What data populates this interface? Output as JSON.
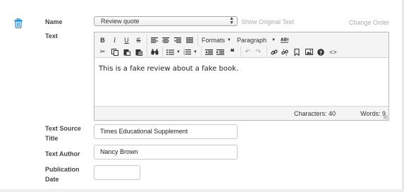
{
  "name_row": {
    "label": "Name",
    "select_value": "Review quote",
    "show_original": "Show Original Text",
    "change_order": "Change Order"
  },
  "text_row": {
    "label": "Text",
    "toolbar": {
      "formats_label": "Formats",
      "paragraph_label": "Paragraph"
    },
    "content": "This is a fake review about a fake book.",
    "status": {
      "characters": "Characters: 40",
      "words": "Words: 9"
    }
  },
  "text_source_title": {
    "label_line1": "Text Source",
    "label_line2": "Title",
    "value": "Times Educational Supplement"
  },
  "text_author": {
    "label": "Text Author",
    "value": "Nancy Brown"
  },
  "publication_date": {
    "label_line1": "Publication",
    "label_line2": "Date",
    "value": ""
  },
  "colors": {
    "trash_icon": "#2a8bd1",
    "link_gray": "#aaaaaa",
    "label": "#444444"
  }
}
